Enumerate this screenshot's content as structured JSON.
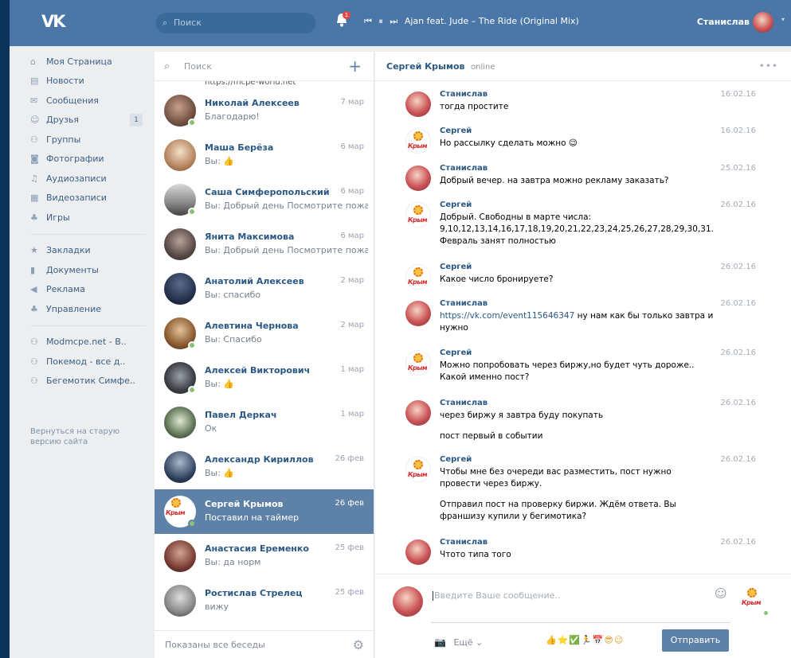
{
  "topbar": {
    "logo": "VK",
    "search_placeholder": "Поиск",
    "notifications_count": "1",
    "now_playing": "Ajan feat. Jude – The Ride (Original Mix)",
    "user_name": "Станислав",
    "accent_color": "#4a76a8"
  },
  "leftnav": {
    "items": [
      {
        "label": "Моя Страница",
        "icon": "home-icon"
      },
      {
        "label": "Новости",
        "icon": "news-icon"
      },
      {
        "label": "Сообщения",
        "icon": "messages-icon"
      },
      {
        "label": "Друзья",
        "icon": "friends-icon",
        "count": "1"
      },
      {
        "label": "Группы",
        "icon": "groups-icon"
      },
      {
        "label": "Фотографии",
        "icon": "camera-icon"
      },
      {
        "label": "Аудиозаписи",
        "icon": "music-icon"
      },
      {
        "label": "Видеозаписи",
        "icon": "video-icon"
      },
      {
        "label": "Игры",
        "icon": "gamepad-icon"
      }
    ],
    "items2": [
      {
        "label": "Закладки",
        "icon": "star-icon"
      },
      {
        "label": "Документы",
        "icon": "document-icon"
      },
      {
        "label": "Реклама",
        "icon": "megaphone-icon"
      },
      {
        "label": "Управление",
        "icon": "gamepad-icon"
      }
    ],
    "groups": [
      {
        "label": "Modmcpe.net - В..",
        "icon": "group-icon"
      },
      {
        "label": "Покемод - все д..",
        "icon": "group-icon"
      },
      {
        "label": "Бегемотик Симфе..",
        "icon": "group-icon"
      }
    ],
    "old_version": "Вернуться на старую версию сайта"
  },
  "dialogs": {
    "search_placeholder": "Поиск",
    "partial_url": "https://mcpe-world.net",
    "items": [
      {
        "name": "Николай Алексеев",
        "date": "7 мар",
        "preview": "Благодарю!",
        "online": true
      },
      {
        "name": "Маша Берёза",
        "date": "6 мар",
        "preview": "Вы: 👍",
        "online": false
      },
      {
        "name": "Саша Симферопольский",
        "date": "6 мар",
        "preview": "Вы: Добрый день Посмотрите пожалу...",
        "online": true
      },
      {
        "name": "Янита Максимова",
        "date": "6 мар",
        "preview": "Вы: Добрый день Посмотрите пожалу...",
        "online": false
      },
      {
        "name": "Анатолий Алексеев",
        "date": "2 мар",
        "preview": "Вы: спасибо",
        "online": false
      },
      {
        "name": "Алевтина Чернова",
        "date": "2 мар",
        "preview": "Вы: Спасибо",
        "online": true
      },
      {
        "name": "Алексей Викторович",
        "date": "1 мар",
        "preview": "Вы: 👍",
        "online": true
      },
      {
        "name": "Павел Деркач",
        "date": "1 мар",
        "preview": "Ок",
        "online": false
      },
      {
        "name": "Александр Кириллов",
        "date": "26 фев",
        "preview": "Вы: 👍",
        "online": false
      },
      {
        "name": "Сергей Крымов",
        "date": "26 фев",
        "preview": "Поставил на таймер",
        "online": true,
        "active": true
      },
      {
        "name": "Анастасия Еременко",
        "date": "25 фев",
        "preview": "Вы: да норм",
        "online": false
      },
      {
        "name": "Ростислав Стрелец",
        "date": "25 фев",
        "preview": "вижу",
        "online": false
      }
    ],
    "footer": "Показаны все беседы"
  },
  "chat": {
    "name": "Сергей Крымов",
    "status": "online",
    "messages": [
      {
        "author": "Станислав",
        "date": "16.02.16",
        "text": "тогда простите"
      },
      {
        "author": "Сергей",
        "date": "16.02.16",
        "text": "Но рассылку сделать можно 😉"
      },
      {
        "author": "Станислав",
        "date": "25.02.16",
        "text": "Добрый вечер. на завтра можно рекламу заказать?"
      },
      {
        "author": "Сергей",
        "date": "26.02.16",
        "text": "Добрый. Свободны в марте числа: 9,10,12,13,14,16,17,18,19,20,21,22,23,24,25,26,27,28,29,30,31. Февраль занят полностью"
      },
      {
        "author": "Сергей",
        "date": "26.02.16",
        "text": "Какое число бронируете?"
      },
      {
        "author": "Станислав",
        "date": "26.02.16",
        "link": "https://vk.com/event115646347",
        "text": " ну нам как бы только завтра и нужно"
      },
      {
        "author": "Сергей",
        "date": "26.02.16",
        "text": "Можно попробовать через биржу,но будет чуть дороже.. Какой именно пост?"
      },
      {
        "author": "Станислав",
        "date": "26.02.16",
        "text": "через биржу я завтра буду покупать",
        "text2": "пост первый в событии"
      },
      {
        "author": "Сергей",
        "date": "26.02.16",
        "text": "Чтобы мне без очереди вас разместить, пост нужно провести через биржу.",
        "text2": "Отправил пост на проверку биржи. Ждём ответа. Вы франшизу купили у бегимотика?"
      },
      {
        "author": "Станислав",
        "date": "26.02.16",
        "text": "Чтото типа того"
      }
    ],
    "composer": {
      "placeholder": "Введите Ваше сообщение..",
      "more_label": "Ещё",
      "emoji_bar": "👍⭐✅🏃📅😎😉",
      "send_label": "Отправить"
    }
  }
}
